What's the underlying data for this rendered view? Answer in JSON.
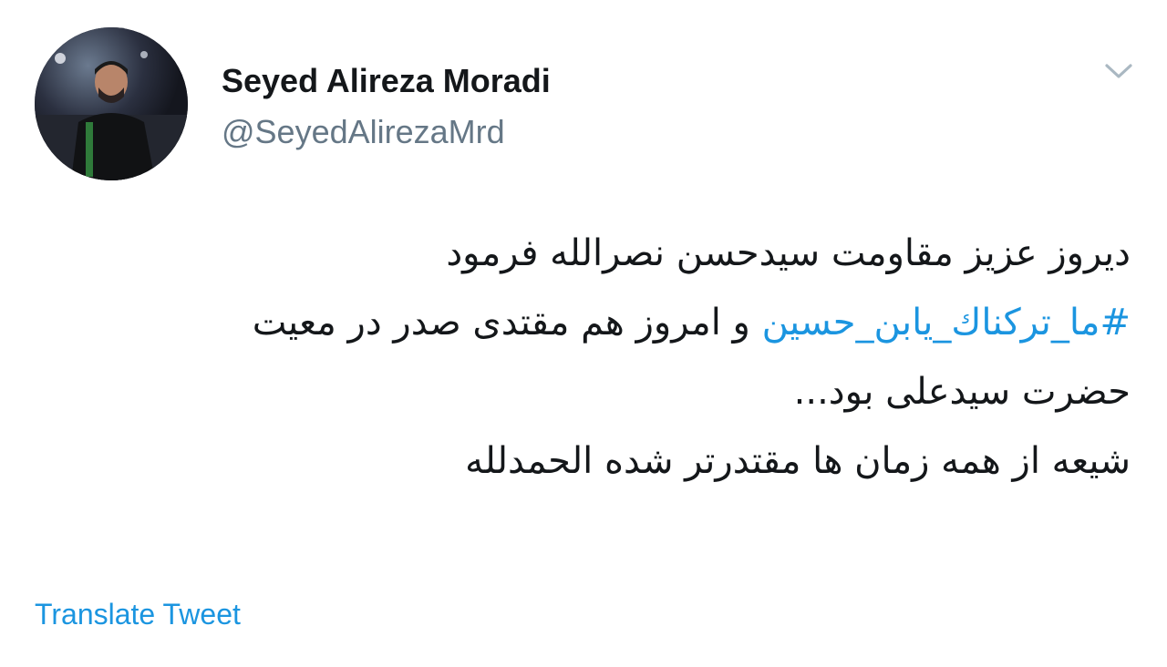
{
  "author": {
    "name": "Seyed Alireza Moradi",
    "handle": "@SeyedAlirezaMrd"
  },
  "tweet": {
    "line1": "دیروز عزیز مقاومت سیدحسن نصرالله فرمود",
    "line2_hashtag": "#ما_ترکناك_یابن_حسین",
    "line2_rest": " و امروز هم مقتدی صدر در معیت",
    "line3": "حضرت سیدعلی بود...",
    "line4": "شیعه از همه زمان ها مقتدرتر شده الحمدلله"
  },
  "actions": {
    "translate_label": "Translate Tweet"
  },
  "icons": {
    "menu": "chevron-down-icon"
  },
  "colors": {
    "link": "#1b95e0",
    "handle": "#657786",
    "text": "#14171a",
    "caret": "#aab8c2"
  }
}
